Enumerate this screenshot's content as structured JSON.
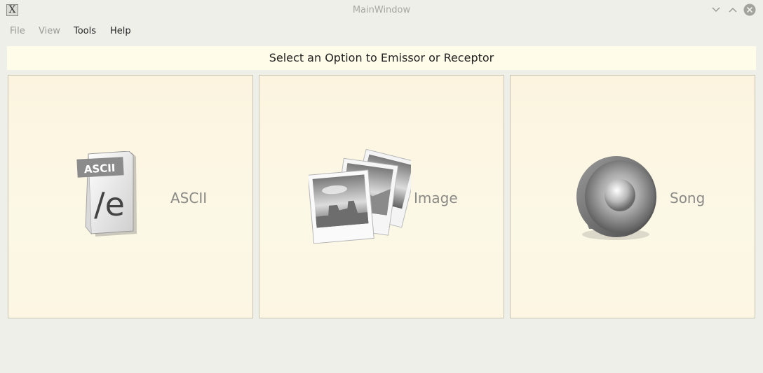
{
  "window": {
    "title": "MainWindow",
    "app_icon_glyph": "X",
    "buttons": [
      "minimize-icon",
      "maximize-icon",
      "close-icon"
    ]
  },
  "menubar": {
    "items": [
      {
        "label": "File",
        "enabled": false
      },
      {
        "label": "View",
        "enabled": false
      },
      {
        "label": "Tools",
        "enabled": true
      },
      {
        "label": "Help",
        "enabled": true
      }
    ]
  },
  "banner": {
    "text": "Select an Option to Emissor or Receptor"
  },
  "options": [
    {
      "label": "ASCII",
      "icon": "ascii-file-icon",
      "icon_badge": "ASCII",
      "icon_glyph": "/e"
    },
    {
      "label": "Image",
      "icon": "photos-icon"
    },
    {
      "label": "Song",
      "icon": "speaker-icon"
    }
  ],
  "colors": {
    "background": "#efefea",
    "banner": "#fffdea",
    "panel": "#fcf6e3",
    "panel_border": "#c7c4b4",
    "option_label": "#8a8a86"
  }
}
